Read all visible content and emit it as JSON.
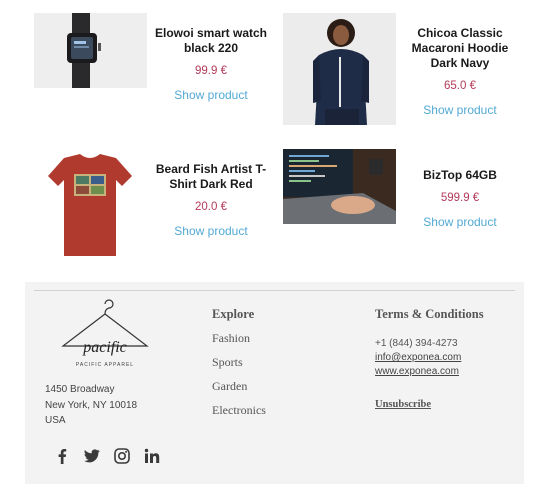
{
  "products": [
    {
      "name": "Elowoi smart watch black 220",
      "price": "99.9 €",
      "cta": "Show product",
      "image": "smart-watch-photo"
    },
    {
      "name": "Chicoa Classic Macaroni Hoodie Dark Navy",
      "price": "65.0 €",
      "cta": "Show product",
      "image": "hoodie-photo"
    },
    {
      "name": "Beard Fish Artist T-Shirt Dark Red",
      "price": "20.0 €",
      "cta": "Show product",
      "image": "tshirt-photo"
    },
    {
      "name": "BizTop 64GB",
      "price": "599.9 €",
      "cta": "Show product",
      "image": "laptop-photo"
    }
  ],
  "footer": {
    "brand": {
      "logo_script": "pacific",
      "logo_tagline": "PACIFIC APPAREL"
    },
    "address": [
      "1450 Broadway",
      "New York, NY 10018",
      "USA"
    ],
    "explore": {
      "title": "Explore",
      "links": [
        "Fashion",
        "Sports",
        "Garden",
        "Electronics"
      ]
    },
    "legal": {
      "title": "Terms & Conditions",
      "phone": "+1 (844) 394-4273",
      "email": "info@exponea.com",
      "website": "www.exponea.com",
      "unsubscribe": "Unsubscribe"
    },
    "social": [
      "facebook-icon",
      "twitter-icon",
      "instagram-icon",
      "linkedin-icon"
    ]
  },
  "colors": {
    "price": "#b33a5a",
    "link": "#52a9d4",
    "footer_bg": "#f3f3f4"
  }
}
